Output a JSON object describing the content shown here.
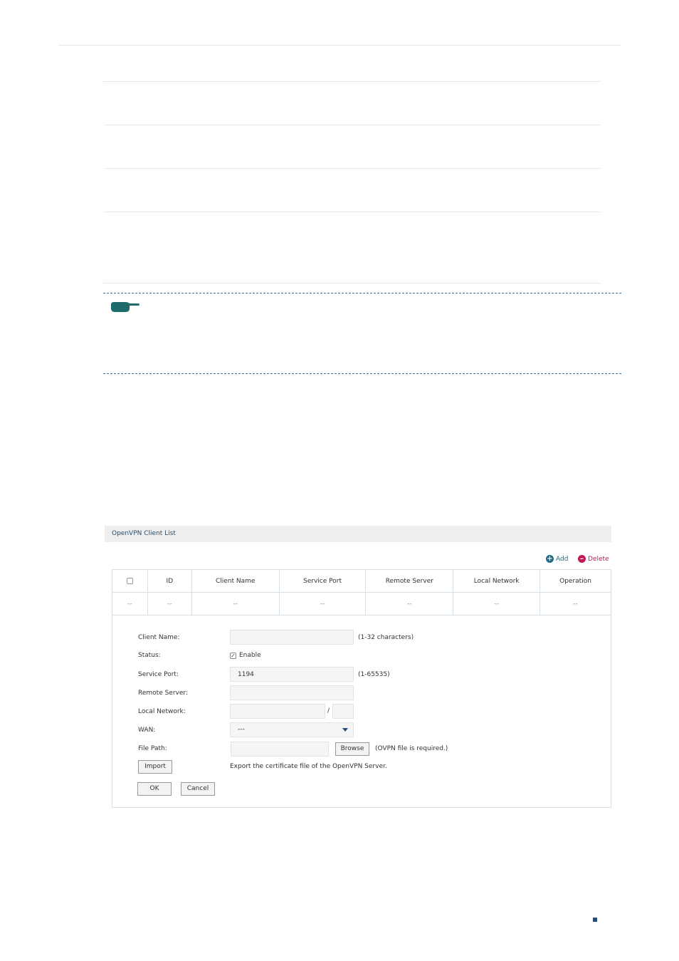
{
  "panel": {
    "title": "OpenVPN Client List",
    "add_label": "Add",
    "delete_label": "Delete",
    "colors": {
      "add": "#1f6b8c",
      "delete": "#c2185b"
    }
  },
  "table": {
    "columns": [
      "ID",
      "Client Name",
      "Service Port",
      "Remote Server",
      "Local Network",
      "Operation"
    ],
    "row": [
      "--",
      "--",
      "--",
      "--",
      "--",
      "--",
      "--"
    ]
  },
  "form": {
    "client_name": {
      "label": "Client Name:",
      "value": "",
      "hint": "(1-32 characters)"
    },
    "status": {
      "label": "Status:",
      "checkbox_label": "Enable",
      "checked": true
    },
    "service_port": {
      "label": "Service Port:",
      "value": "1194",
      "hint": "(1-65535)"
    },
    "remote_server": {
      "label": "Remote Server:",
      "value": ""
    },
    "local_network": {
      "label": "Local Network:",
      "ip": "",
      "separator": "/",
      "mask": ""
    },
    "wan": {
      "label": "WAN:",
      "value": "---"
    },
    "file_path": {
      "label": "File Path:",
      "value": "",
      "browse_label": "Browse",
      "hint": "(OVPN file is required.)"
    },
    "import": {
      "button_label": "Import",
      "description": "Export the certificate file of the OpenVPN Server."
    },
    "ok_label": "OK",
    "cancel_label": "Cancel"
  }
}
